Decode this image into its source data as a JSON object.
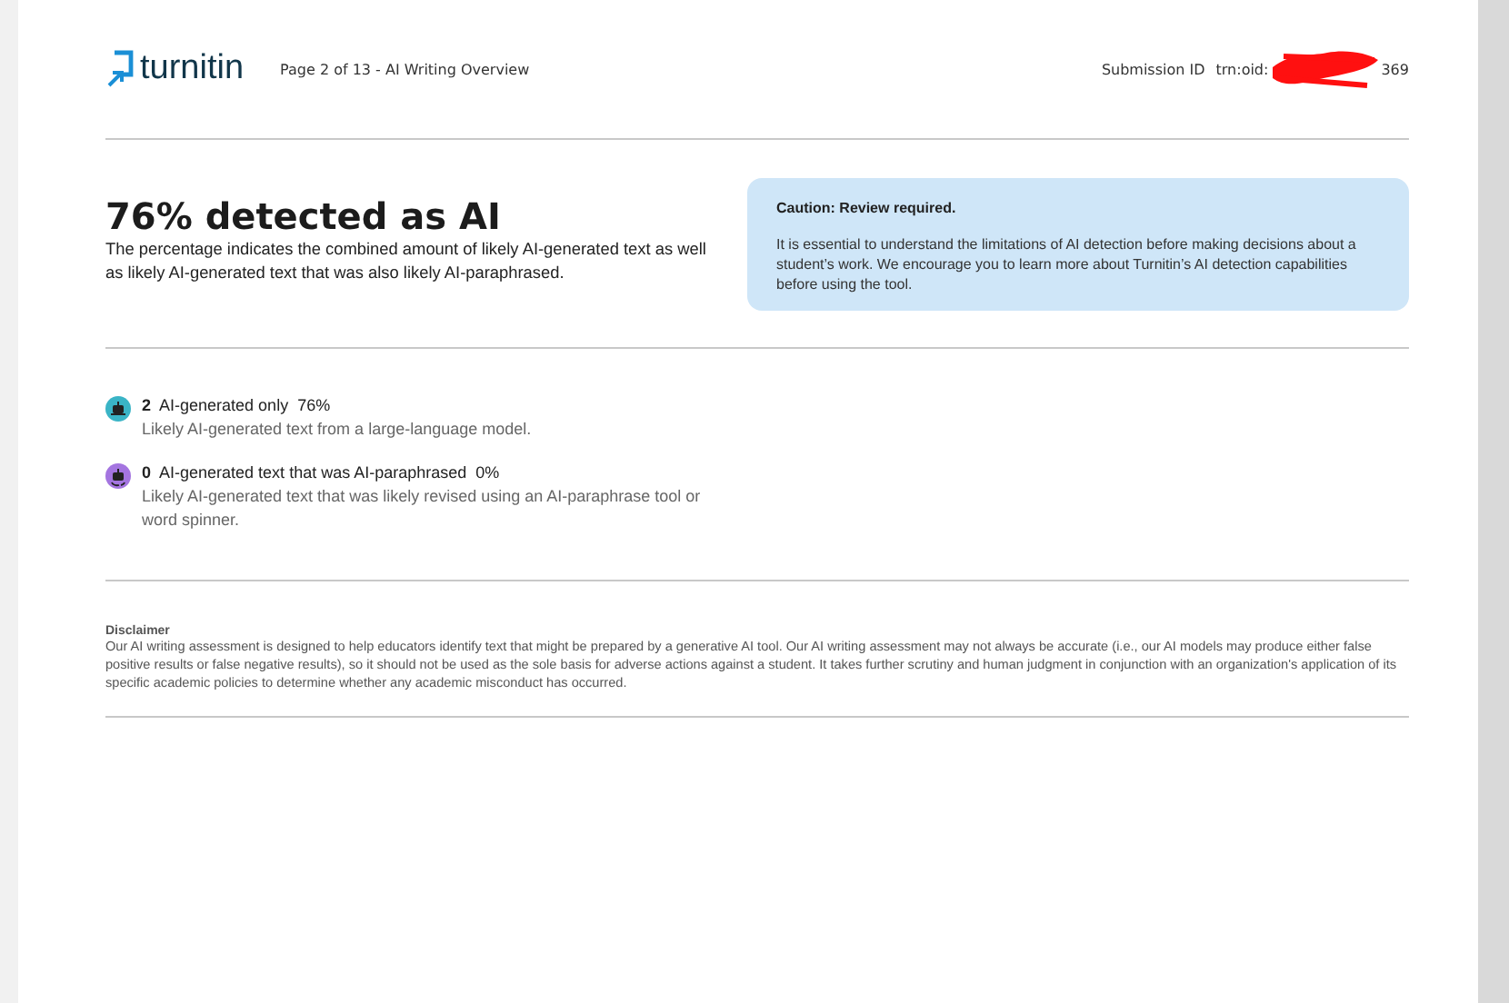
{
  "header": {
    "logo": "turnitin",
    "page_info": "Page 2 of 13 - AI Writing Overview",
    "submission_label": "Submission ID",
    "submission_id_start": "trn:oid:",
    "submission_id_end": "369",
    "redacted": true
  },
  "summary": {
    "title": "76% detected as AI",
    "description": "The percentage indicates the combined amount of likely AI-generated text as well as likely AI-generated text that was also likely AI-paraphrased."
  },
  "caution": {
    "title": "Caution: Review required.",
    "body": "It is essential to understand the limitations of AI detection before making decisions about a student’s work. We encourage you to learn more about Turnitin’s AI detection capabilities before using the tool."
  },
  "categories": [
    {
      "kind": "generated",
      "color": "#3ab4c6",
      "count": "2",
      "label": "AI-generated only",
      "percent": "76%",
      "description": "Likely AI-generated text from a large-language model."
    },
    {
      "kind": "paraphrased",
      "color": "#a475e0",
      "count": "0",
      "label": "AI-generated text that was AI-paraphrased",
      "percent": "0%",
      "description": "Likely AI-generated text that was likely revised using an AI-paraphrase tool or word spinner."
    }
  ],
  "disclaimer": {
    "title": "Disclaimer",
    "body": "Our AI writing assessment is designed to help educators identify text that might be prepared by a generative AI tool. Our AI writing assessment may not always be accurate (i.e., our AI models may produce either false positive results or false negative results), so it should not be used as the sole basis for adverse actions against a student. It takes further scrutiny and human judgment in conjunction with an organization's application of its specific academic policies to determine whether any academic misconduct has occurred."
  }
}
